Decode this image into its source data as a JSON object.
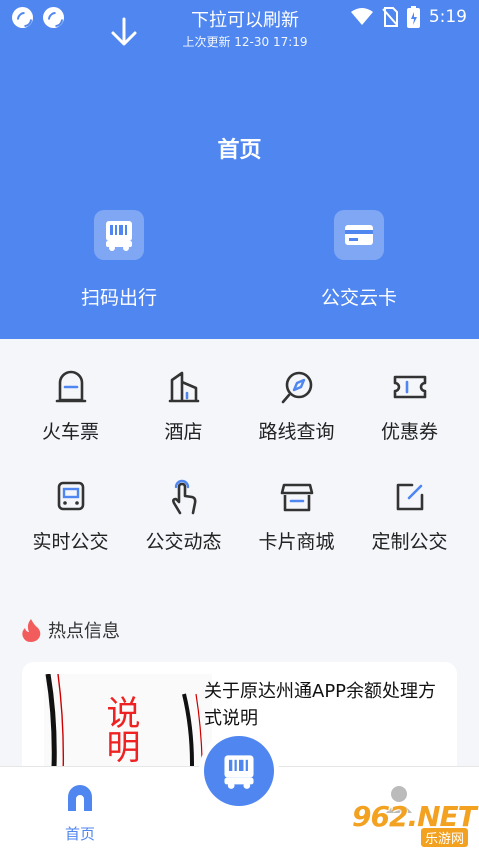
{
  "status_bar": {
    "time": "5:19"
  },
  "refresh": {
    "title": "下拉可以刷新",
    "subtitle": "上次更新 12-30 17:19"
  },
  "header": {
    "title": "首页",
    "quick_actions": [
      {
        "label": "扫码出行",
        "icon": "qr-bus-icon"
      },
      {
        "label": "公交云卡",
        "icon": "card-icon"
      }
    ]
  },
  "services": [
    {
      "label": "火车票",
      "icon": "train-icon"
    },
    {
      "label": "酒店",
      "icon": "hotel-icon"
    },
    {
      "label": "路线查询",
      "icon": "compass-icon"
    },
    {
      "label": "优惠券",
      "icon": "coupon-icon"
    },
    {
      "label": "实时公交",
      "icon": "bus-icon"
    },
    {
      "label": "公交动态",
      "icon": "tap-icon"
    },
    {
      "label": "卡片商城",
      "icon": "shop-icon"
    },
    {
      "label": "定制公交",
      "icon": "edit-icon"
    }
  ],
  "hot": {
    "title": "热点信息",
    "news": [
      {
        "title": "关于原达州通APP余额处理方式说明",
        "thumb_text": "说明"
      }
    ]
  },
  "tabbar": {
    "home_label": "首页"
  },
  "watermark": {
    "main": "962.NET",
    "sub": "乐游网"
  },
  "colors": {
    "primary": "#4f86f0",
    "accent_flame": "#f25c5c"
  }
}
